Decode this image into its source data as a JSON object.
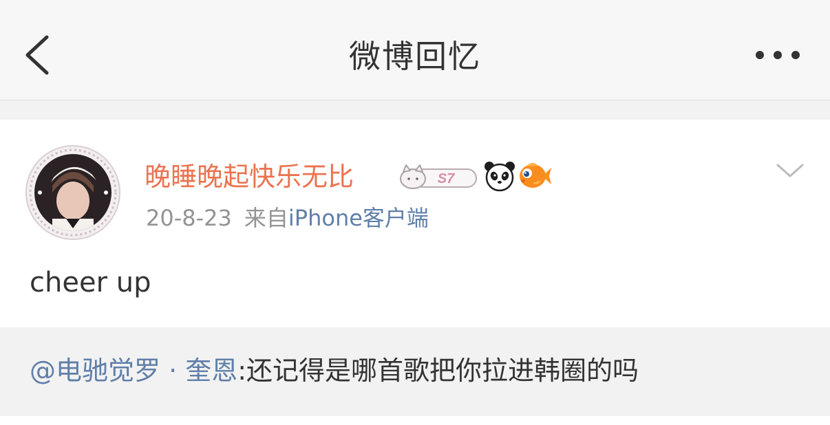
{
  "header": {
    "title": "微博回忆",
    "back_icon": "chevron-left-icon",
    "more_icon": "more-dots-icon"
  },
  "post": {
    "username": "晚睡晚起快乐无比",
    "badges": [
      "s7-cat-badge",
      "panda-badge",
      "goldfish-badge"
    ],
    "badge_s7_text": "S7",
    "date": "20-8-23",
    "source_prefix": "来自",
    "source": "iPhone客户端",
    "content": "cheer up",
    "dropdown_icon": "chevron-down-icon"
  },
  "quote": {
    "mention": "@电驰觉罗 · 奎恩",
    "text": ":还记得是哪首歌把你拉进韩圈的吗"
  },
  "colors": {
    "username": "#eb7350",
    "link": "#5f7fa8",
    "meta_gray": "#939393",
    "text": "#333333"
  }
}
